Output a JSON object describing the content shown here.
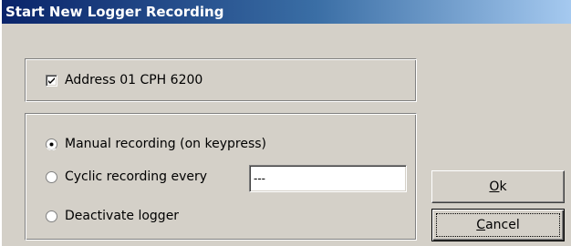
{
  "window": {
    "title": "Start New Logger Recording"
  },
  "address_group": {
    "checkbox_label": "Address 01 CPH 6200",
    "checked": true
  },
  "mode_group": {
    "options": [
      {
        "label": "Manual recording (on keypress)",
        "selected": true
      },
      {
        "label": "Cyclic recording every",
        "selected": false
      },
      {
        "label": "Deactivate logger",
        "selected": false
      }
    ],
    "interval_value": "---"
  },
  "buttons": {
    "ok_mnemonic": "O",
    "ok_rest": "k",
    "cancel_mnemonic": "C",
    "cancel_rest": "ancel"
  },
  "colors": {
    "face": "#d4d0c8",
    "title_start": "#0a246a",
    "title_end": "#a6caf0"
  }
}
